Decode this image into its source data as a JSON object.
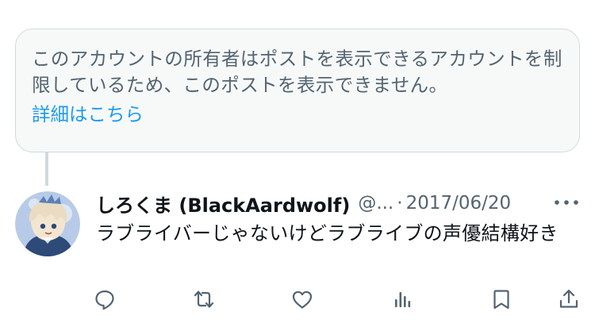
{
  "notice": {
    "text": "このアカウントの所有者はポストを表示できるアカウントを制限しているため、このポストを表示できません。",
    "link": "詳細はこちら"
  },
  "post": {
    "display_name": "しろくま (BlackAardwolf)",
    "handle": "@...",
    "separator": "·",
    "date": "2017/06/20",
    "text": "ラブライバーじゃないけどラブライブの声優結構好き"
  },
  "actions": [
    "reply-icon",
    "repost-icon",
    "like-icon",
    "views-icon",
    "bookmark-icon",
    "share-icon"
  ],
  "colors": {
    "secondary_text": "#536471",
    "link": "#1d9bf0",
    "border": "#cfd9de",
    "notice_bg": "#f7f9f9",
    "avatar_bg": "#b7cbe8"
  }
}
